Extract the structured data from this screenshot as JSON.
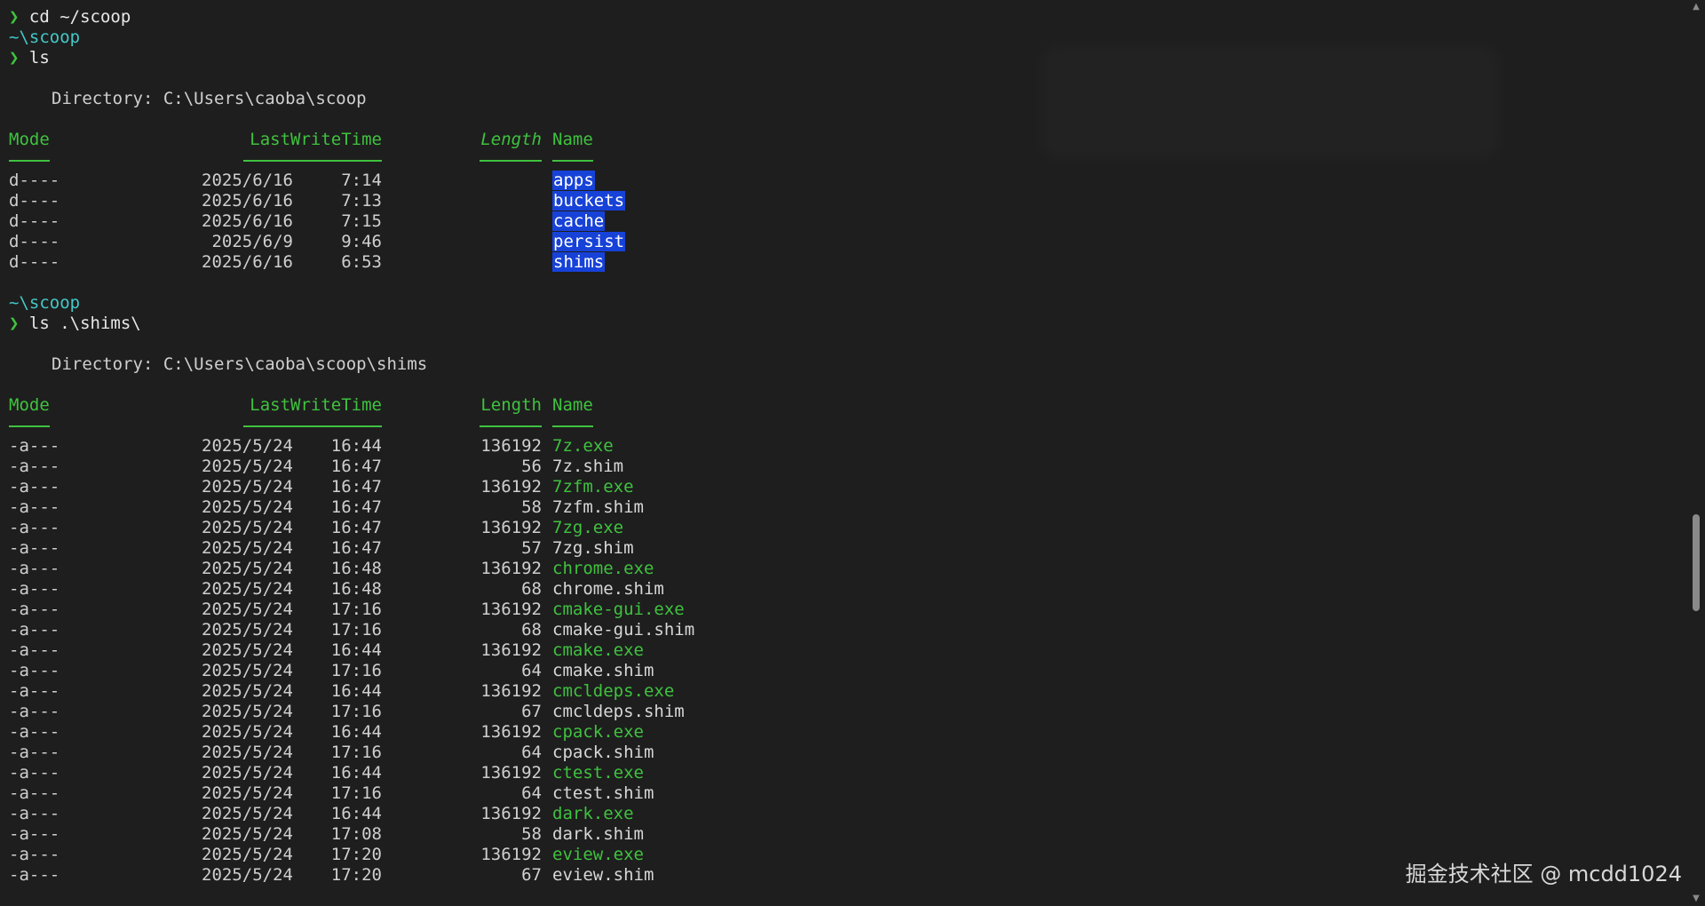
{
  "commands": {
    "first": "cd ~/scoop",
    "second": "ls",
    "third": "ls .\\shims\\"
  },
  "prompt": {
    "char": "❯",
    "path": "~\\scoop"
  },
  "listing1": {
    "directory_label": "Directory: C:\\Users\\caoba\\scoop",
    "headers": {
      "mode": "Mode",
      "time": "LastWriteTime",
      "length": "Length",
      "name": "Name"
    },
    "rows": [
      {
        "mode": "d----",
        "date": "2025/6/16",
        "time": "7:14",
        "length": "",
        "name": "apps"
      },
      {
        "mode": "d----",
        "date": "2025/6/16",
        "time": "7:13",
        "length": "",
        "name": "buckets"
      },
      {
        "mode": "d----",
        "date": "2025/6/16",
        "time": "7:15",
        "length": "",
        "name": "cache"
      },
      {
        "mode": "d----",
        "date": "2025/6/9",
        "time": "9:46",
        "length": "",
        "name": "persist"
      },
      {
        "mode": "d----",
        "date": "2025/6/16",
        "time": "6:53",
        "length": "",
        "name": "shims"
      }
    ]
  },
  "listing2": {
    "directory_label": "Directory: C:\\Users\\caoba\\scoop\\shims",
    "headers": {
      "mode": "Mode",
      "time": "LastWriteTime",
      "length": "Length",
      "name": "Name"
    },
    "rows": [
      {
        "mode": "-a---",
        "date": "2025/5/24",
        "time": "16:44",
        "length": "136192",
        "name": "7z.exe",
        "kind": "exe"
      },
      {
        "mode": "-a---",
        "date": "2025/5/24",
        "time": "16:47",
        "length": "56",
        "name": "7z.shim",
        "kind": "shim"
      },
      {
        "mode": "-a---",
        "date": "2025/5/24",
        "time": "16:47",
        "length": "136192",
        "name": "7zfm.exe",
        "kind": "exe"
      },
      {
        "mode": "-a---",
        "date": "2025/5/24",
        "time": "16:47",
        "length": "58",
        "name": "7zfm.shim",
        "kind": "shim"
      },
      {
        "mode": "-a---",
        "date": "2025/5/24",
        "time": "16:47",
        "length": "136192",
        "name": "7zg.exe",
        "kind": "exe"
      },
      {
        "mode": "-a---",
        "date": "2025/5/24",
        "time": "16:47",
        "length": "57",
        "name": "7zg.shim",
        "kind": "shim"
      },
      {
        "mode": "-a---",
        "date": "2025/5/24",
        "time": "16:48",
        "length": "136192",
        "name": "chrome.exe",
        "kind": "exe"
      },
      {
        "mode": "-a---",
        "date": "2025/5/24",
        "time": "16:48",
        "length": "68",
        "name": "chrome.shim",
        "kind": "shim"
      },
      {
        "mode": "-a---",
        "date": "2025/5/24",
        "time": "17:16",
        "length": "136192",
        "name": "cmake-gui.exe",
        "kind": "exe"
      },
      {
        "mode": "-a---",
        "date": "2025/5/24",
        "time": "17:16",
        "length": "68",
        "name": "cmake-gui.shim",
        "kind": "shim"
      },
      {
        "mode": "-a---",
        "date": "2025/5/24",
        "time": "16:44",
        "length": "136192",
        "name": "cmake.exe",
        "kind": "exe"
      },
      {
        "mode": "-a---",
        "date": "2025/5/24",
        "time": "17:16",
        "length": "64",
        "name": "cmake.shim",
        "kind": "shim"
      },
      {
        "mode": "-a---",
        "date": "2025/5/24",
        "time": "16:44",
        "length": "136192",
        "name": "cmcldeps.exe",
        "kind": "exe"
      },
      {
        "mode": "-a---",
        "date": "2025/5/24",
        "time": "17:16",
        "length": "67",
        "name": "cmcldeps.shim",
        "kind": "shim"
      },
      {
        "mode": "-a---",
        "date": "2025/5/24",
        "time": "16:44",
        "length": "136192",
        "name": "cpack.exe",
        "kind": "exe"
      },
      {
        "mode": "-a---",
        "date": "2025/5/24",
        "time": "17:16",
        "length": "64",
        "name": "cpack.shim",
        "kind": "shim"
      },
      {
        "mode": "-a---",
        "date": "2025/5/24",
        "time": "16:44",
        "length": "136192",
        "name": "ctest.exe",
        "kind": "exe"
      },
      {
        "mode": "-a---",
        "date": "2025/5/24",
        "time": "17:16",
        "length": "64",
        "name": "ctest.shim",
        "kind": "shim"
      },
      {
        "mode": "-a---",
        "date": "2025/5/24",
        "time": "16:44",
        "length": "136192",
        "name": "dark.exe",
        "kind": "exe"
      },
      {
        "mode": "-a---",
        "date": "2025/5/24",
        "time": "17:08",
        "length": "58",
        "name": "dark.shim",
        "kind": "shim"
      },
      {
        "mode": "-a---",
        "date": "2025/5/24",
        "time": "17:20",
        "length": "136192",
        "name": "eview.exe",
        "kind": "exe"
      },
      {
        "mode": "-a---",
        "date": "2025/5/24",
        "time": "17:20",
        "length": "67",
        "name": "eview.shim",
        "kind": "shim"
      }
    ]
  },
  "watermark": "掘金技术社区 @ mcdd1024",
  "colors": {
    "background": "#1e1e1e",
    "prompt_green": "#3fc23f",
    "path_cyan": "#44c8c8",
    "dir_highlight": "#1742d8",
    "text": "#cfcfcf"
  },
  "scrollbar": {
    "position_fraction": 0.64,
    "thumb_fraction": 0.11
  }
}
